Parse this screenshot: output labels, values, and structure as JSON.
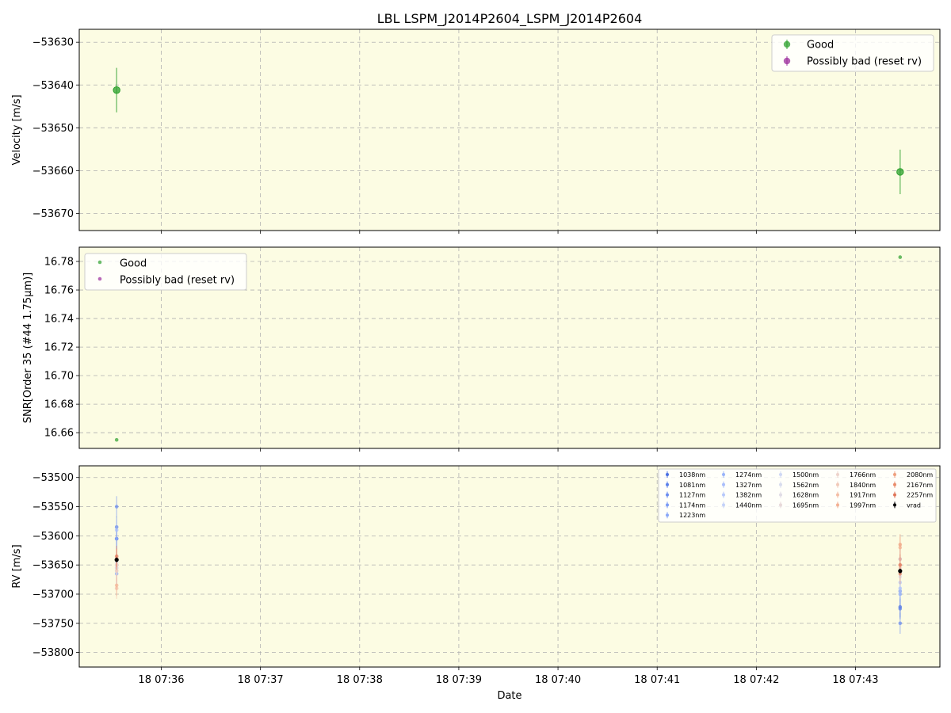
{
  "chart_data": [
    {
      "type": "scatter",
      "title": "LBL LSPM_J2014P2604_LSPM_J2014P2604",
      "ylabel": "Velocity [m/s]",
      "xlabel": "",
      "background": "#fcfce3",
      "grid": true,
      "legend": "top-right",
      "ylim": [
        -53674,
        -53627
      ],
      "yticks": [
        -53630,
        -53640,
        -53650,
        -53660,
        -53670
      ],
      "ytick_labels": [
        "−53630",
        "−53640",
        "−53650",
        "−53660",
        "−53670"
      ],
      "series": [
        {
          "name": "Good",
          "color": "#2ca02c",
          "points": [
            {
              "x": "18 07:35:33",
              "y": -53641.2,
              "err": 5.2
            },
            {
              "x": "18 07:43:27",
              "y": -53660.3,
              "err": 5.2
            }
          ]
        },
        {
          "name": "Possibly bad (reset rv)",
          "color": "#9b2b9b",
          "points": []
        }
      ]
    },
    {
      "type": "scatter",
      "title": "",
      "ylabel": "SNR[Order 35 (#44 1.75μm)]",
      "xlabel": "",
      "background": "#fcfce3",
      "grid": true,
      "legend": "top-left",
      "ylim": [
        16.649,
        16.79
      ],
      "yticks": [
        16.66,
        16.68,
        16.7,
        16.72,
        16.74,
        16.76,
        16.78
      ],
      "ytick_labels": [
        "16.66",
        "16.68",
        "16.70",
        "16.72",
        "16.74",
        "16.76",
        "16.78"
      ],
      "series": [
        {
          "name": "Good",
          "color": "#2ca02c",
          "points": [
            {
              "x": "18 07:35:33",
              "y": 16.655
            },
            {
              "x": "18 07:43:27",
              "y": 16.783
            }
          ]
        },
        {
          "name": "Possibly bad (reset rv)",
          "color": "#9b2b9b",
          "points": []
        }
      ]
    },
    {
      "type": "scatter",
      "title": "",
      "ylabel": "RV [m/s]",
      "xlabel": "Date",
      "background": "#fcfce3",
      "grid": true,
      "legend": "top-right",
      "ylim": [
        -53825,
        -53480
      ],
      "yticks": [
        -53500,
        -53550,
        -53600,
        -53650,
        -53700,
        -53750,
        -53800
      ],
      "ytick_labels": [
        "−53500",
        "−53550",
        "−53600",
        "−53650",
        "−53700",
        "−53750",
        "−53800"
      ],
      "xticks": [
        "07:36",
        "07:37",
        "07:38",
        "07:39",
        "07:40",
        "07:41",
        "07:42",
        "07:43"
      ],
      "xtick_labels": [
        "18 07:36",
        "18 07:37",
        "18 07:38",
        "18 07:39",
        "18 07:40",
        "18 07:41",
        "18 07:42",
        "18 07:43"
      ],
      "series": [
        {
          "name": "1038nm",
          "color": "#4a6fe3",
          "values": [
            -53605,
            -53722
          ]
        },
        {
          "name": "1081nm",
          "color": "#5b80ea",
          "values": [
            -53585,
            -53725
          ]
        },
        {
          "name": "1127nm",
          "color": "#6a8cf0",
          "values": [
            -53550,
            -53750
          ]
        },
        {
          "name": "1174nm",
          "color": "#7a9af5",
          "values": [
            -53605,
            -53695
          ]
        },
        {
          "name": "1223nm",
          "color": "#8aa8f8",
          "values": [
            -53665,
            -53700
          ]
        },
        {
          "name": "1274nm",
          "color": "#9ab4fa",
          "values": [
            -53640,
            -53640
          ]
        },
        {
          "name": "1327nm",
          "color": "#aabffb",
          "values": [
            -53590,
            -53690
          ]
        },
        {
          "name": "1382nm",
          "color": "#b7c9fb",
          "values": [
            -53655,
            -53680
          ]
        },
        {
          "name": "1440nm",
          "color": "#c4d2f9",
          "values": [
            -53650,
            -53660
          ]
        },
        {
          "name": "1500nm",
          "color": "#cfd8f4",
          "values": [
            -53660,
            -53665
          ]
        },
        {
          "name": "1562nm",
          "color": "#d8dcee",
          "values": [
            -53645,
            -53670
          ]
        },
        {
          "name": "1628nm",
          "color": "#e0dce5",
          "values": [
            -53650,
            -53660
          ]
        },
        {
          "name": "1695nm",
          "color": "#e7d9d9",
          "values": [
            -53655,
            -53660
          ]
        },
        {
          "name": "1766nm",
          "color": "#eed3cb",
          "values": [
            -53650,
            -53655
          ]
        },
        {
          "name": "1840nm",
          "color": "#f2cab9",
          "values": [
            -53660,
            -53650
          ]
        },
        {
          "name": "1917nm",
          "color": "#f4bea5",
          "values": [
            -53690,
            -53640
          ]
        },
        {
          "name": "1997nm",
          "color": "#f3b092",
          "values": [
            -53685,
            -53620
          ]
        },
        {
          "name": "2080nm",
          "color": "#ef9f7e",
          "values": [
            -53640,
            -53615
          ]
        },
        {
          "name": "2167nm",
          "color": "#e98c6b",
          "values": [
            -53640,
            -53665
          ]
        },
        {
          "name": "2257nm",
          "color": "#df7558",
          "values": [
            -53635,
            -53650
          ]
        },
        {
          "name": "vrad",
          "color": "#000000",
          "values": [
            -53641.2,
            -53660.3
          ]
        }
      ],
      "x": [
        "18 07:35:33",
        "18 07:43:27"
      ]
    }
  ]
}
